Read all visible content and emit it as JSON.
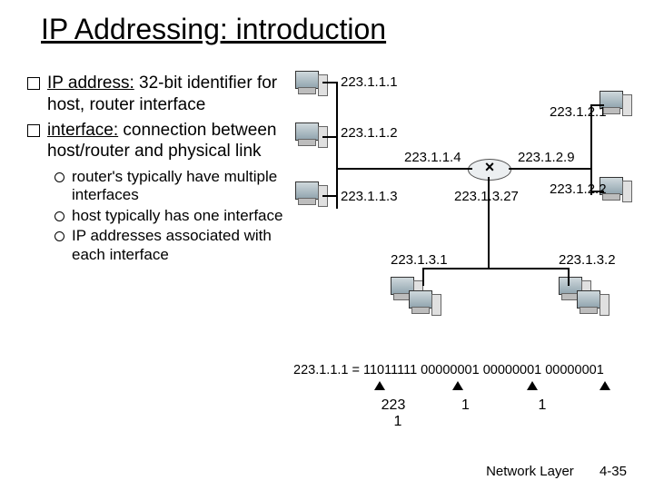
{
  "title": "IP Addressing: introduction",
  "bullets": {
    "b1_pre": "IP address:",
    "b1_post": " 32-bit identifier for host, router interface",
    "b2_pre": "interface:",
    "b2_post": " connection between host/router and physical link",
    "s1": "router's typically have multiple interfaces",
    "s2": "host typically has one interface",
    "s3": "IP addresses associated with each interface"
  },
  "ips": {
    "a": "223.1.1.1",
    "b": "223.1.1.2",
    "c": "223.1.1.3",
    "d": "223.1.1.4",
    "e": "223.1.2.1",
    "f": "223.1.2.9",
    "g": "223.1.2.2",
    "h": "223.1.3.27",
    "i": "223.1.3.1",
    "j": "223.1.3.2"
  },
  "binary": {
    "eq": "223.1.1.1 = 11011111 00000001 00000001 00000001",
    "n1": "223",
    "n2": "1",
    "n3": "1",
    "n4": "1"
  },
  "footer": {
    "label": "Network Layer",
    "page": "4-35"
  }
}
